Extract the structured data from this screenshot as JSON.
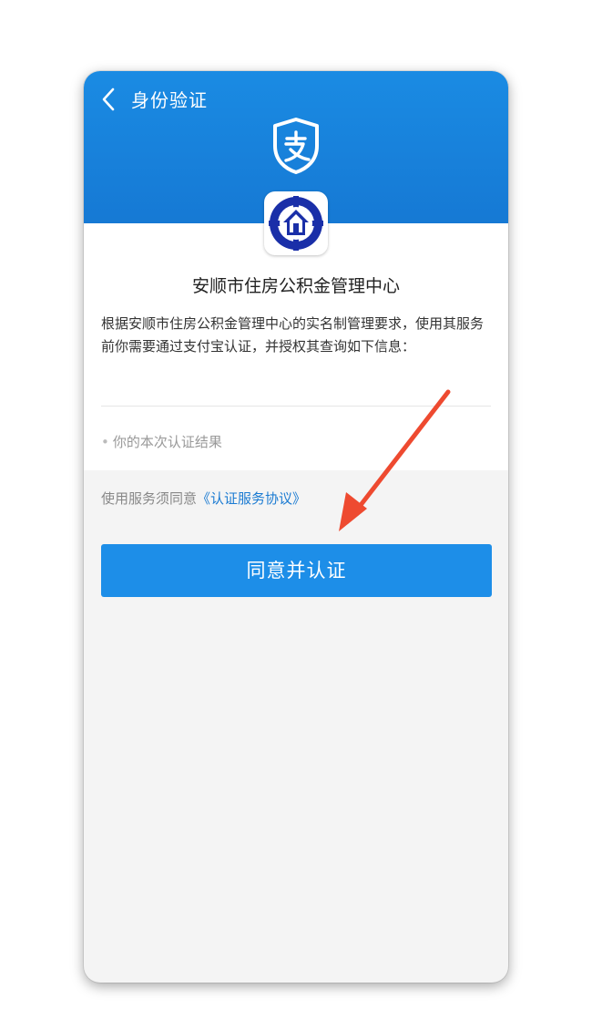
{
  "header": {
    "back_icon": "chevron-left-icon",
    "title": "身份验证",
    "brand_icon": "alipay-shield-icon",
    "color": "#1a8be3"
  },
  "org": {
    "logo_icon": "housing-fund-logo-icon",
    "name": "安顺市住房公积金管理中心"
  },
  "description": "根据安顺市住房公积金管理中心的实名制管理要求，使用其服务前你需要通过支付宝认证，并授权其查询如下信息：",
  "authorized_items": [
    {
      "label": "你的本次认证结果"
    }
  ],
  "agreement": {
    "prefix": "使用服务须同意",
    "link_label": "《认证服务协议》"
  },
  "confirm_button": {
    "label": "同意并认证",
    "color": "#1d8ee8"
  },
  "annotation": {
    "arrow_color": "#ee4a30"
  }
}
